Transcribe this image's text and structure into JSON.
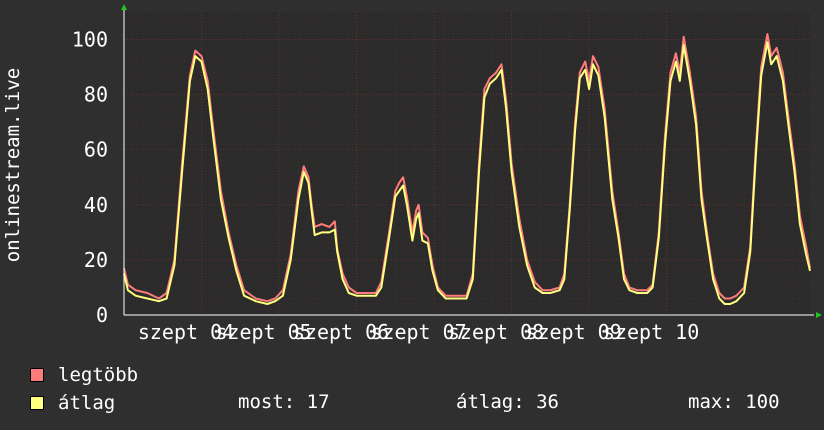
{
  "chart_data": {
    "type": "line",
    "ylabel": "onlinestream.live",
    "ylim": [
      0,
      110
    ],
    "yticks": [
      0,
      20,
      40,
      60,
      80,
      100
    ],
    "x_tick_labels": [
      "szept 04",
      "szept 05",
      "szept 06",
      "szept 07",
      "szept 08",
      "szept 09",
      "szept 10"
    ],
    "x_tick_days": [
      0.8,
      1.8,
      2.8,
      3.8,
      4.8,
      5.8,
      6.8
    ],
    "xlim_days": [
      0,
      7.9
    ],
    "grid": true,
    "series": [
      {
        "name": "legtöbb",
        "color": "#ff7c7c",
        "points": [
          [
            0.0,
            17
          ],
          [
            0.05,
            11
          ],
          [
            0.15,
            9
          ],
          [
            0.3,
            8
          ],
          [
            0.45,
            6
          ],
          [
            0.55,
            8
          ],
          [
            0.65,
            20
          ],
          [
            0.75,
            55
          ],
          [
            0.85,
            87
          ],
          [
            0.92,
            96
          ],
          [
            1.0,
            94
          ],
          [
            1.08,
            85
          ],
          [
            1.15,
            68
          ],
          [
            1.25,
            45
          ],
          [
            1.35,
            30
          ],
          [
            1.45,
            18
          ],
          [
            1.55,
            9
          ],
          [
            1.7,
            6
          ],
          [
            1.85,
            5
          ],
          [
            1.95,
            6
          ],
          [
            2.05,
            9
          ],
          [
            2.15,
            22
          ],
          [
            2.25,
            45
          ],
          [
            2.32,
            54
          ],
          [
            2.38,
            50
          ],
          [
            2.42,
            40
          ],
          [
            2.46,
            32
          ],
          [
            2.55,
            33
          ],
          [
            2.65,
            32
          ],
          [
            2.72,
            34
          ],
          [
            2.75,
            24
          ],
          [
            2.82,
            15
          ],
          [
            2.9,
            10
          ],
          [
            3.0,
            8
          ],
          [
            3.15,
            8
          ],
          [
            3.25,
            8
          ],
          [
            3.32,
            12
          ],
          [
            3.42,
            30
          ],
          [
            3.5,
            45
          ],
          [
            3.55,
            48
          ],
          [
            3.6,
            50
          ],
          [
            3.65,
            43
          ],
          [
            3.72,
            30
          ],
          [
            3.77,
            38
          ],
          [
            3.8,
            40
          ],
          [
            3.85,
            30
          ],
          [
            3.92,
            28
          ],
          [
            3.98,
            18
          ],
          [
            4.05,
            10
          ],
          [
            4.15,
            7
          ],
          [
            4.3,
            7
          ],
          [
            4.42,
            7
          ],
          [
            4.5,
            15
          ],
          [
            4.58,
            55
          ],
          [
            4.65,
            82
          ],
          [
            4.72,
            86
          ],
          [
            4.8,
            88
          ],
          [
            4.87,
            91
          ],
          [
            4.93,
            78
          ],
          [
            5.0,
            55
          ],
          [
            5.1,
            35
          ],
          [
            5.2,
            20
          ],
          [
            5.3,
            12
          ],
          [
            5.4,
            9
          ],
          [
            5.5,
            9
          ],
          [
            5.62,
            10
          ],
          [
            5.68,
            15
          ],
          [
            5.75,
            40
          ],
          [
            5.82,
            70
          ],
          [
            5.88,
            88
          ],
          [
            5.95,
            92
          ],
          [
            6.0,
            85
          ],
          [
            6.05,
            94
          ],
          [
            6.12,
            90
          ],
          [
            6.2,
            75
          ],
          [
            6.3,
            45
          ],
          [
            6.38,
            30
          ],
          [
            6.45,
            15
          ],
          [
            6.52,
            10
          ],
          [
            6.62,
            9
          ],
          [
            6.75,
            9
          ],
          [
            6.82,
            11
          ],
          [
            6.9,
            30
          ],
          [
            6.98,
            65
          ],
          [
            7.05,
            88
          ],
          [
            7.12,
            95
          ],
          [
            7.17,
            88
          ],
          [
            7.22,
            101
          ],
          [
            7.3,
            88
          ],
          [
            7.38,
            72
          ],
          [
            7.45,
            45
          ],
          [
            7.52,
            30
          ],
          [
            7.6,
            15
          ],
          [
            7.68,
            8
          ],
          [
            7.75,
            6
          ],
          [
            7.82,
            6
          ],
          [
            7.9,
            7
          ],
          [
            8.0,
            10
          ],
          [
            8.08,
            25
          ],
          [
            8.15,
            60
          ],
          [
            8.22,
            90
          ],
          [
            8.3,
            102
          ],
          [
            8.35,
            94
          ],
          [
            8.42,
            97
          ],
          [
            8.5,
            88
          ],
          [
            8.58,
            70
          ],
          [
            8.65,
            55
          ],
          [
            8.72,
            36
          ],
          [
            8.8,
            25
          ],
          [
            8.85,
            17
          ]
        ]
      },
      {
        "name": "átlag",
        "color": "#ffff80",
        "points": [
          [
            0.0,
            15
          ],
          [
            0.05,
            9
          ],
          [
            0.15,
            7
          ],
          [
            0.3,
            6
          ],
          [
            0.45,
            5
          ],
          [
            0.55,
            6
          ],
          [
            0.65,
            18
          ],
          [
            0.75,
            52
          ],
          [
            0.85,
            85
          ],
          [
            0.92,
            94
          ],
          [
            1.0,
            92
          ],
          [
            1.08,
            82
          ],
          [
            1.15,
            65
          ],
          [
            1.25,
            42
          ],
          [
            1.35,
            28
          ],
          [
            1.45,
            16
          ],
          [
            1.55,
            7
          ],
          [
            1.7,
            5
          ],
          [
            1.85,
            4
          ],
          [
            1.95,
            5
          ],
          [
            2.05,
            7
          ],
          [
            2.15,
            20
          ],
          [
            2.25,
            42
          ],
          [
            2.32,
            52
          ],
          [
            2.38,
            48
          ],
          [
            2.42,
            38
          ],
          [
            2.46,
            29
          ],
          [
            2.55,
            30
          ],
          [
            2.65,
            30
          ],
          [
            2.72,
            31
          ],
          [
            2.75,
            23
          ],
          [
            2.82,
            13
          ],
          [
            2.9,
            8
          ],
          [
            3.0,
            7
          ],
          [
            3.15,
            7
          ],
          [
            3.25,
            7
          ],
          [
            3.32,
            10
          ],
          [
            3.42,
            28
          ],
          [
            3.5,
            43
          ],
          [
            3.55,
            45
          ],
          [
            3.6,
            47
          ],
          [
            3.65,
            40
          ],
          [
            3.72,
            27
          ],
          [
            3.77,
            35
          ],
          [
            3.8,
            37
          ],
          [
            3.85,
            27
          ],
          [
            3.92,
            26
          ],
          [
            3.98,
            16
          ],
          [
            4.05,
            9
          ],
          [
            4.15,
            6
          ],
          [
            4.3,
            6
          ],
          [
            4.42,
            6
          ],
          [
            4.5,
            13
          ],
          [
            4.58,
            52
          ],
          [
            4.65,
            79
          ],
          [
            4.72,
            84
          ],
          [
            4.8,
            86
          ],
          [
            4.87,
            89
          ],
          [
            4.93,
            75
          ],
          [
            5.0,
            52
          ],
          [
            5.1,
            32
          ],
          [
            5.2,
            18
          ],
          [
            5.3,
            10
          ],
          [
            5.4,
            8
          ],
          [
            5.5,
            8
          ],
          [
            5.62,
            9
          ],
          [
            5.68,
            13
          ],
          [
            5.75,
            38
          ],
          [
            5.82,
            67
          ],
          [
            5.88,
            86
          ],
          [
            5.95,
            89
          ],
          [
            6.0,
            82
          ],
          [
            6.05,
            91
          ],
          [
            6.12,
            87
          ],
          [
            6.2,
            72
          ],
          [
            6.3,
            42
          ],
          [
            6.38,
            28
          ],
          [
            6.45,
            13
          ],
          [
            6.52,
            9
          ],
          [
            6.62,
            8
          ],
          [
            6.75,
            8
          ],
          [
            6.82,
            10
          ],
          [
            6.9,
            28
          ],
          [
            6.98,
            62
          ],
          [
            7.05,
            85
          ],
          [
            7.12,
            92
          ],
          [
            7.17,
            85
          ],
          [
            7.22,
            98
          ],
          [
            7.3,
            85
          ],
          [
            7.38,
            69
          ],
          [
            7.45,
            42
          ],
          [
            7.52,
            28
          ],
          [
            7.6,
            13
          ],
          [
            7.68,
            6
          ],
          [
            7.75,
            4
          ],
          [
            7.82,
            4
          ],
          [
            7.9,
            5
          ],
          [
            8.0,
            8
          ],
          [
            8.08,
            23
          ],
          [
            8.15,
            57
          ],
          [
            8.22,
            87
          ],
          [
            8.3,
            99
          ],
          [
            8.35,
            91
          ],
          [
            8.42,
            94
          ],
          [
            8.5,
            85
          ],
          [
            8.58,
            67
          ],
          [
            8.65,
            52
          ],
          [
            8.72,
            33
          ],
          [
            8.8,
            22
          ],
          [
            8.85,
            16
          ]
        ]
      }
    ],
    "legend": [
      {
        "label": "legtöbb",
        "color": "#ff7c7c"
      },
      {
        "label": "átlag",
        "color": "#ffff80"
      }
    ],
    "stats": {
      "most": "most: 17",
      "atlag": "átlag: 36",
      "max": "max: 100"
    }
  }
}
